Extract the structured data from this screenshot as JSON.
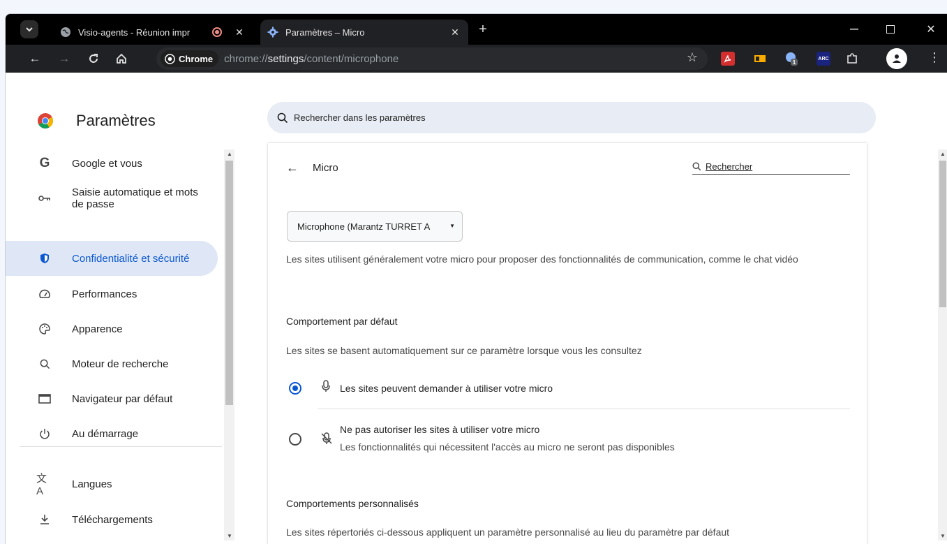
{
  "tabs": [
    {
      "title": "Visio-agents - Réunion impr",
      "icon": "globe-icon",
      "recording": true
    },
    {
      "title": "Paramètres – Micro",
      "icon": "settings-gear-icon",
      "active": true
    }
  ],
  "toolbar": {
    "chip_label": "Chrome",
    "url_prefix": "chrome://",
    "url_host": "settings",
    "url_path": "/content/microphone"
  },
  "extensions": [
    {
      "name": "pdf-extension-icon",
      "color": "#d32f2f"
    },
    {
      "name": "notes-extension-icon",
      "color": "#f9ab00"
    },
    {
      "name": "puzzle-badge-extension-icon",
      "color": "#4285f4",
      "badge": "1"
    },
    {
      "name": "arc-extension-icon",
      "label": "ARC",
      "color": "#1a237e"
    }
  ],
  "settings": {
    "title": "Paramètres",
    "search_placeholder": "Rechercher dans les paramètres"
  },
  "sidebar": {
    "items": [
      {
        "label": "Google et vous",
        "icon": "google-g-icon"
      },
      {
        "label": "Saisie automatique et mots de passe",
        "icon": "key-icon"
      },
      {
        "label": "Confidentialité et sécurité",
        "icon": "shield-icon",
        "selected": true
      },
      {
        "label": "Performances",
        "icon": "speedometer-icon"
      },
      {
        "label": "Apparence",
        "icon": "palette-icon"
      },
      {
        "label": "Moteur de recherche",
        "icon": "search-icon"
      },
      {
        "label": "Navigateur par défaut",
        "icon": "browser-window-icon"
      },
      {
        "label": "Au démarrage",
        "icon": "power-icon"
      },
      {
        "label": "Langues",
        "icon": "translate-icon"
      },
      {
        "label": "Téléchargements",
        "icon": "download-icon"
      }
    ]
  },
  "page": {
    "title": "Micro",
    "search_label": "Rechercher",
    "device_selected": "Microphone (Marantz TURRET A",
    "description": "Les sites utilisent généralement votre micro pour proposer des fonctionnalités de communication, comme le chat vidéo",
    "default_heading": "Comportement par défaut",
    "default_sub": "Les sites se basent automatiquement sur ce paramètre lorsque vous les consultez",
    "option_allow": "Les sites peuvent demander à utiliser votre micro",
    "option_block": "Ne pas autoriser les sites à utiliser votre micro",
    "option_block_sub": "Les fonctionnalités qui nécessitent l'accès au micro ne seront pas disponibles",
    "custom_heading": "Comportements personnalisés",
    "custom_sub": "Les sites répertoriés ci-dessous appliquent un paramètre personnalisé au lieu du paramètre par défaut"
  },
  "colors": {
    "accent": "#0b57d0",
    "selected_bg": "#dfe7f6"
  }
}
